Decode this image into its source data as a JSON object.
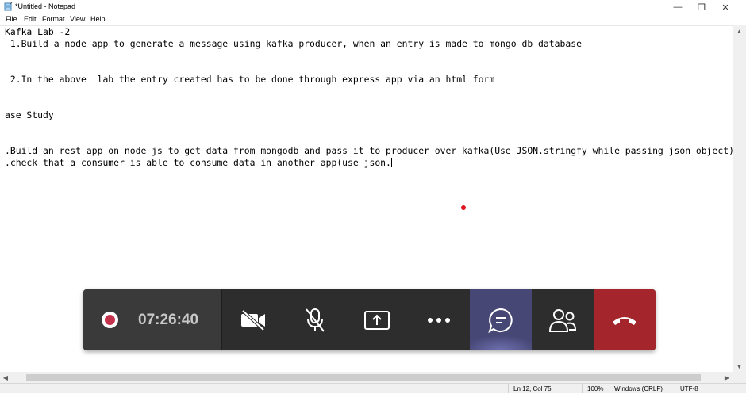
{
  "window": {
    "title": "*Untitled - Notepad",
    "controls": {
      "minimize": "—",
      "maximize": "❐",
      "close": "✕"
    }
  },
  "menu": {
    "items": [
      "File",
      "Edit",
      "Format",
      "View",
      "Help"
    ]
  },
  "editor": {
    "lines": [
      "Kafka Lab -2",
      " 1.Build a node app to generate a message using kafka producer, when an entry is made to mongo db database",
      "",
      "",
      " 2.In the above  lab the entry created has to be done through express app via an html form",
      "",
      "",
      "ase Study",
      "",
      "",
      ".Build an rest app on node js to get data from mongodb and pass it to producer over kafka(Use JSON.stringfy while passing json object)",
      ".check that a consumer is able to consume data in another app(use json."
    ]
  },
  "statusbar": {
    "position": "Ln 12, Col 75",
    "zoom": "100%",
    "line_ending": "Windows (CRLF)",
    "encoding": "UTF-8"
  },
  "meeting": {
    "timer": "07:26:40",
    "icons": [
      "record-icon",
      "video-off-icon",
      "mic-off-icon",
      "share-screen-icon",
      "more-icon",
      "chat-icon",
      "participants-icon",
      "hang-up-icon"
    ],
    "colors": {
      "bar": "#2d2d2d",
      "chat_active": "#464775",
      "hang_up": "#a4262c",
      "record": "#c4314b"
    }
  }
}
